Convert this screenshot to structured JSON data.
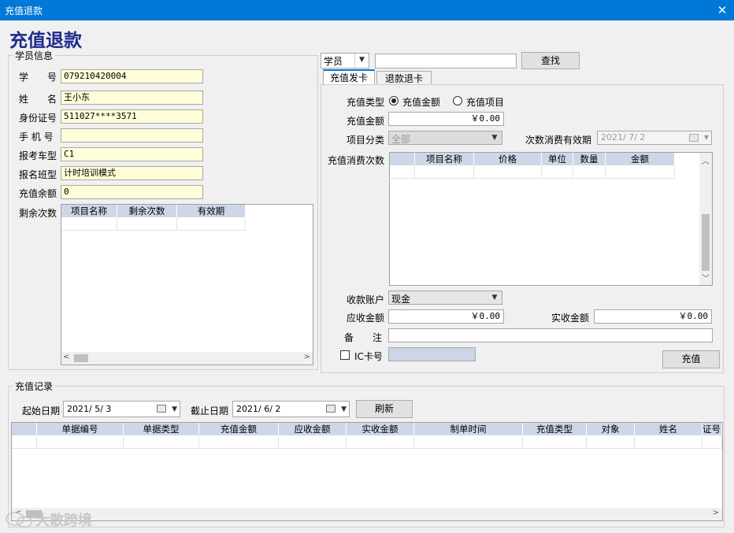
{
  "window": {
    "title": "充值退款"
  },
  "page_title": "充值退款",
  "student_info": {
    "group_title": "学员信息",
    "fields": [
      {
        "label": "学　　号",
        "value": "079210420004"
      },
      {
        "label": "姓　　名",
        "value": "王小东"
      },
      {
        "label": "身份证号",
        "value": "511027****3571"
      },
      {
        "label": "手 机 号",
        "value": ""
      },
      {
        "label": "报考车型",
        "value": "C1"
      },
      {
        "label": "报名班型",
        "value": "计时培训模式"
      },
      {
        "label": "充值余额",
        "value": "0"
      }
    ],
    "remaining_label": "剩余次数",
    "remaining_columns": [
      "项目名称",
      "剩余次数",
      "有效期"
    ]
  },
  "search": {
    "type_value": "学员",
    "query": "",
    "button": "查找"
  },
  "tabs": [
    {
      "label": "充值发卡"
    },
    {
      "label": "退款退卡"
    }
  ],
  "recharge": {
    "type_label": "充值类型",
    "type_options": [
      "充值金额",
      "充值项目"
    ],
    "amount_label": "充值金额",
    "amount_value": "￥0.00",
    "category_label": "项目分类",
    "category_value": "全部",
    "validity_label": "次数消费有效期",
    "validity_value": "2021/ 7/ 2",
    "consume_label": "充值消费次数",
    "consume_columns": [
      "项目名称",
      "价格",
      "单位",
      "数量",
      "金额"
    ],
    "account_label": "收款账户",
    "account_value": "现金",
    "receivable_label": "应收金额",
    "receivable_value": "￥0.00",
    "received_label": "实收金额",
    "received_value": "￥0.00",
    "remark_label": "备　　注",
    "remark_value": "",
    "ic_label": "IC卡号",
    "ic_value": "",
    "submit": "充值"
  },
  "records": {
    "group_title": "充值记录",
    "start_label": "起始日期",
    "start_value": "2021/ 5/ 3",
    "end_label": "截止日期",
    "end_value": "2021/ 6/ 2",
    "refresh": "刷新",
    "columns": [
      "单据编号",
      "单据类型",
      "充值金额",
      "应收金额",
      "实收金额",
      "制单时间",
      "充值类型",
      "对象",
      "姓名",
      "证号"
    ]
  },
  "watermark": "大散跨境"
}
